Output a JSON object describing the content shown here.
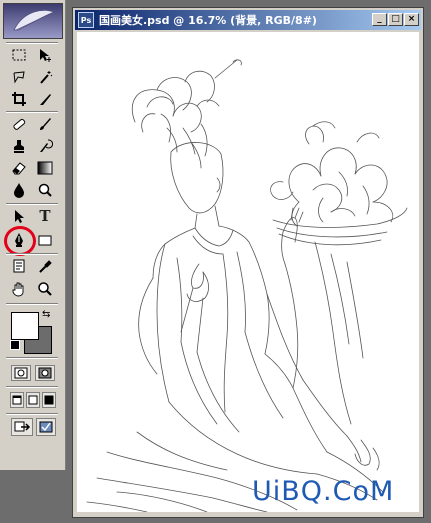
{
  "document": {
    "title": "国画美女.psd @ 16.7% (背景, RGB/8#)",
    "minimize_label": "_",
    "maximize_label": "□",
    "close_label": "×"
  },
  "toolbox": {
    "tools": [
      {
        "name": "marquee-tool-icon"
      },
      {
        "name": "move-tool-icon"
      },
      {
        "name": "lasso-tool-icon"
      },
      {
        "name": "magic-wand-tool-icon"
      },
      {
        "name": "crop-tool-icon"
      },
      {
        "name": "slice-tool-icon"
      },
      {
        "name": "healing-brush-tool-icon"
      },
      {
        "name": "brush-tool-icon"
      },
      {
        "name": "clone-stamp-tool-icon"
      },
      {
        "name": "history-brush-tool-icon"
      },
      {
        "name": "eraser-tool-icon"
      },
      {
        "name": "gradient-tool-icon"
      },
      {
        "name": "blur-tool-icon"
      },
      {
        "name": "dodge-tool-icon"
      },
      {
        "name": "path-selection-tool-icon"
      },
      {
        "name": "type-tool-icon"
      },
      {
        "name": "pen-tool-icon"
      },
      {
        "name": "shape-tool-icon"
      },
      {
        "name": "notes-tool-icon"
      },
      {
        "name": "eyedropper-tool-icon"
      },
      {
        "name": "hand-tool-icon"
      },
      {
        "name": "zoom-tool-icon"
      }
    ],
    "type_tool_label": "T",
    "foreground_color": "#ffffff",
    "background_color": "#6c6c6c",
    "highlight_color": "#e2001a",
    "active_tool": "pen-tool-icon"
  },
  "watermark": "UiBQ.CoM"
}
